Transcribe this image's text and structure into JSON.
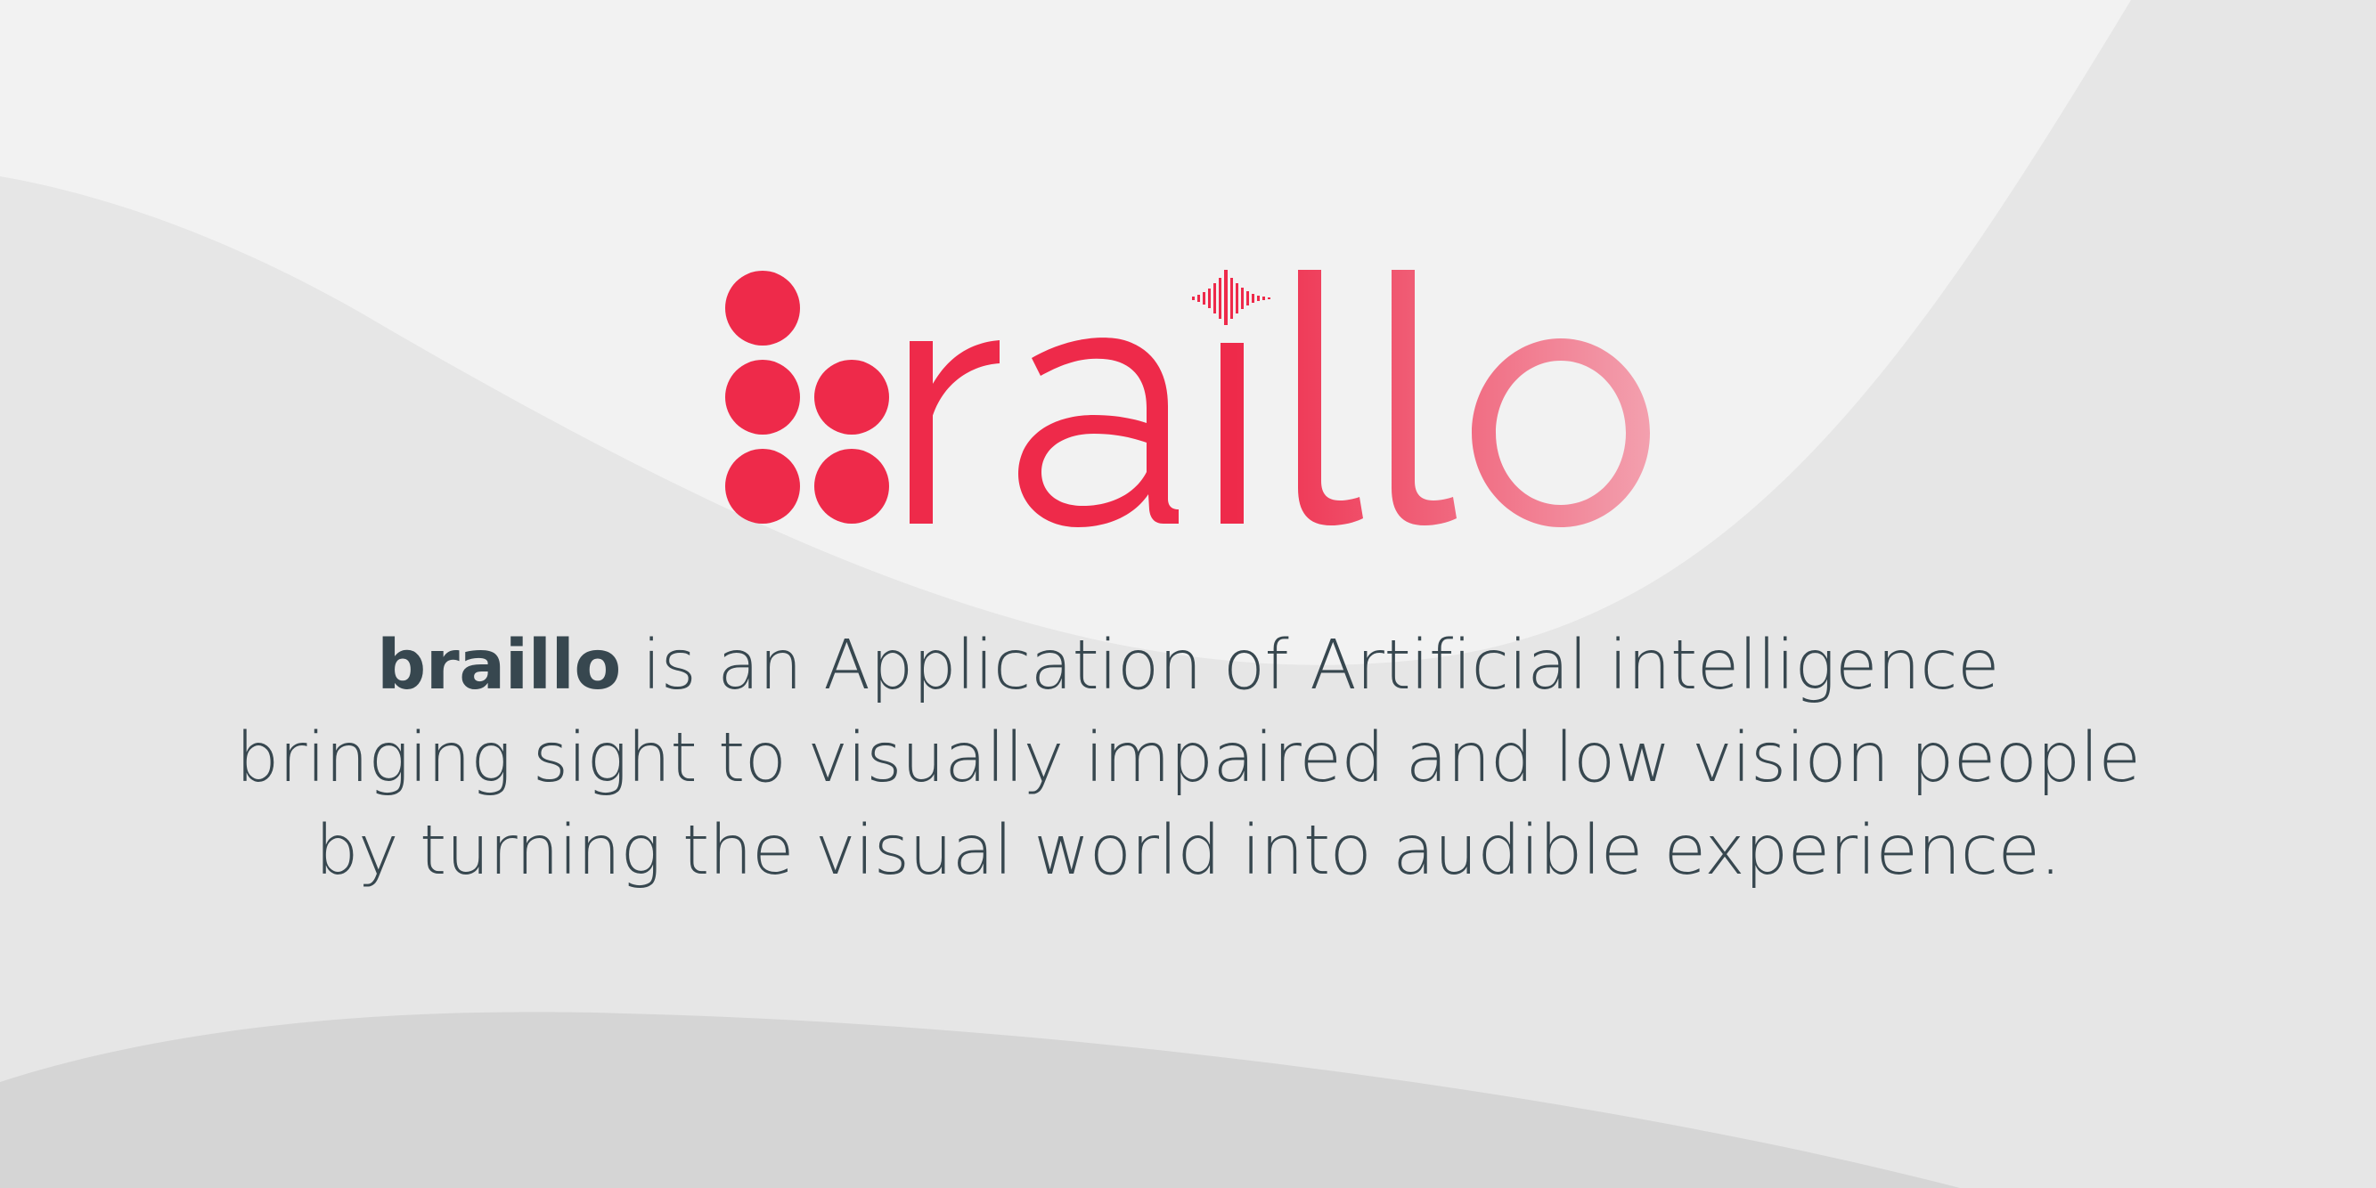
{
  "brand": {
    "name": "braillo",
    "logo_icon": "braille-dots-icon",
    "sound_icon": "sound-wave-icon",
    "colors": {
      "primary": "#ee2a4a",
      "gradient_end": "#f3a2b0",
      "text": "#37474f",
      "background_light": "#f2f2f2",
      "background_mid": "#e6e6e6",
      "background_dark": "#d5d5d5"
    }
  },
  "tagline": {
    "brand_word": "braillo",
    "line1_rest": " is an Application of Artificial intelligence",
    "line2": "bringing sight to visually impaired and low vision people",
    "line3": "by turning the visual world into audible experience."
  }
}
